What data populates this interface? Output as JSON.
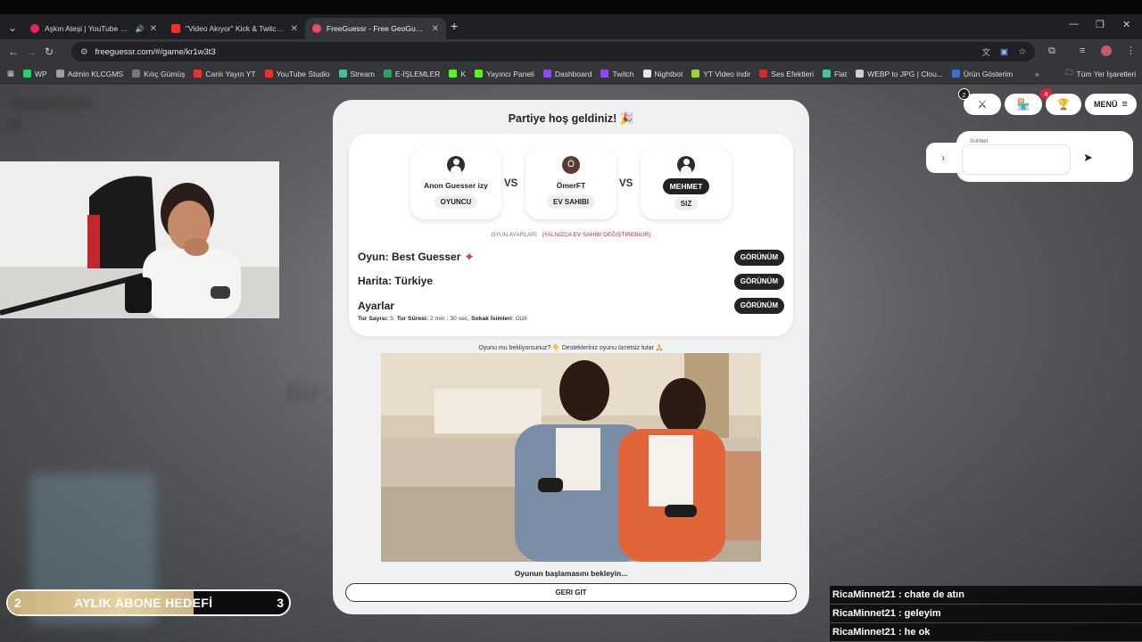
{
  "browser": {
    "tabs": [
      {
        "label": "Aşkın Ateşi | YouTube Music",
        "color": "#e0245e"
      },
      {
        "label": "\"Video Akıyor\" Kick & Twitch K...",
        "color": "#ff2a2a"
      },
      {
        "label": "FreeGuessr - Free GeoGuessr Al...",
        "color": "#e94b6a"
      }
    ],
    "url": "freeguessr.com/#/game/kr1w3t3",
    "bookmarks": [
      {
        "label": "WP",
        "color": "#25d366"
      },
      {
        "label": "Admin KLCGMS",
        "color": "#9aa0a6"
      },
      {
        "label": "Kılıç Gümüş",
        "color": "#777"
      },
      {
        "label": "Canlı Yayın YT",
        "color": "#ff2a2a"
      },
      {
        "label": "YouTube Studio",
        "color": "#ff2a2a"
      },
      {
        "label": "Stream",
        "color": "#40c0a0"
      },
      {
        "label": "E-İŞLEMLER",
        "color": "#25a85a"
      },
      {
        "label": "K",
        "color": "#53fc18"
      },
      {
        "label": "Yayıncı Paneli",
        "color": "#53fc18"
      },
      {
        "label": "Dashboard",
        "color": "#9146ff"
      },
      {
        "label": "Twitch",
        "color": "#9146ff"
      },
      {
        "label": "Nightbot",
        "color": "#e8e8e8"
      },
      {
        "label": "YT Video indir",
        "color": "#9bd435"
      },
      {
        "label": "Ses Efektleri",
        "color": "#d62b2b"
      },
      {
        "label": "Flat",
        "color": "#3cc8a0"
      },
      {
        "label": "WEBP to JPG | Clou...",
        "color": "#d0d0d0"
      },
      {
        "label": "Ürün Gösterim",
        "color": "#3b6fd8"
      }
    ],
    "all_bookmarks": "Tüm Yer İşaretleri"
  },
  "modal": {
    "title": "Partiye hoş geldiniz! 🎉",
    "players": [
      {
        "name": "Anon Guesser izy",
        "role": "OYUNCU"
      },
      {
        "name": "ÖmerFT",
        "role": "EV SAHIBI",
        "initial": "Ö"
      },
      {
        "name": "MEHMET",
        "role": "SIZ"
      }
    ],
    "vs": "VS",
    "settings_head": "OYUN AYARLARI",
    "settings_warn": "(YALNIZCA EV SAHIBI DEĞIŞTIREBILIR)",
    "rows": [
      {
        "label": "Oyun: Best Guesser",
        "button": "GÖRÜNÜM"
      },
      {
        "label": "Harita: Türkiye",
        "button": "GÖRÜNÜM"
      },
      {
        "label": "Ayarlar",
        "button": "GÖRÜNÜM"
      }
    ],
    "details": {
      "rounds_label": "Tur Sayısı:",
      "rounds": " 5, ",
      "time_label": "Tur Süresi:",
      "time": " 2 min : 30 sec, ",
      "street_label": "Sokak İsimleri",
      "street": ": Gizli"
    },
    "support": "Oyunu mu bekliyorsunuz? 👇 Destekleriniz oyunu ücretsiz tutar 🙏",
    "waiting": "Oyunun başlamasını bekleyin...",
    "back": "GERI GIT"
  },
  "top_right": {
    "battle_badge": "2",
    "shop_badge": "4",
    "menu": "MENÜ"
  },
  "chat": {
    "label": "Sohbet"
  },
  "overlay": {
    "sub_goal_current": "2",
    "sub_goal_label": "AYLIK ABONE HEDEFİ",
    "sub_goal_target": "3",
    "sub_goal_progress": 0.66,
    "stream_chat": [
      "RicaMinnet21 : chate de atın",
      "RicaMinnet21 : geleyim",
      "RicaMinnet21 : he ok"
    ]
  },
  "blurred_text": "Bir ... ama ... ruyu!"
}
